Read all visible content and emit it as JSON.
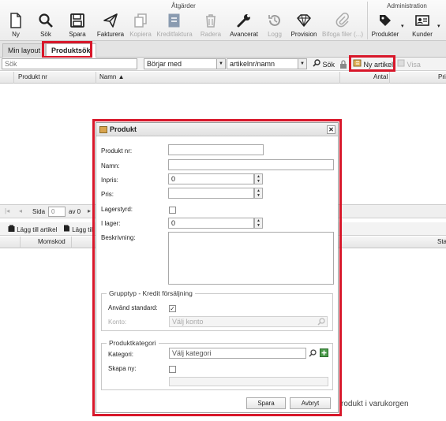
{
  "ribbon": {
    "groups": {
      "actions": "Åtgärder",
      "admin": "Administration"
    },
    "buttons": {
      "new": "Ny",
      "search": "Sök",
      "save": "Spara",
      "invoice": "Fakturera",
      "copy": "Kopiera",
      "credit": "Kreditfaktura",
      "delete": "Radera",
      "advanced": "Avancerat",
      "log": "Logg",
      "commission": "Provision",
      "attach": "Bifoga filer (...)",
      "products": "Produkter",
      "customers": "Kunder"
    }
  },
  "tabs": {
    "my_layout": "Min layout",
    "product_search": "Produktsök"
  },
  "search": {
    "placeholder": "Sök",
    "mode": "Börjar med",
    "field": "artikelnr/namn",
    "search_button": "Sök",
    "new_article": "Ny artikel",
    "view": "Visa"
  },
  "grid": {
    "col_product_nr": "Produkt nr",
    "col_name": "Namn",
    "col_qty": "Antal",
    "col_price": "Pris"
  },
  "pager": {
    "page_label": "Sida",
    "page_value": "0",
    "of_label": "av 0"
  },
  "lower": {
    "add_article": "Lägg till artikel",
    "add_other": "Lägg till",
    "col_vat": "Momskod",
    "col_sta": "Sta",
    "cart_text": "rodukt i varukorgen"
  },
  "dialog": {
    "title": "Produkt",
    "labels": {
      "product_nr": "Produkt nr:",
      "name": "Namn:",
      "purchase_price": "Inpris:",
      "price": "Pris:",
      "stock_managed": "Lagerstyrd:",
      "in_stock": "I lager:",
      "description": "Beskrivning:"
    },
    "values": {
      "purchase_price": "0",
      "in_stock": "0"
    },
    "group_type": {
      "legend": "Grupptyp - Kredit försäljning",
      "use_default_label": "Använd standard:",
      "account_label": "Konto:",
      "account_placeholder": "Välj konto"
    },
    "category": {
      "legend": "Produktkategori",
      "category_label": "Kategori:",
      "category_placeholder": "Välj kategori",
      "create_new_label": "Skapa ny:"
    },
    "save": "Spara",
    "cancel": "Avbryt"
  },
  "colors": {
    "highlight": "#d8172a"
  }
}
